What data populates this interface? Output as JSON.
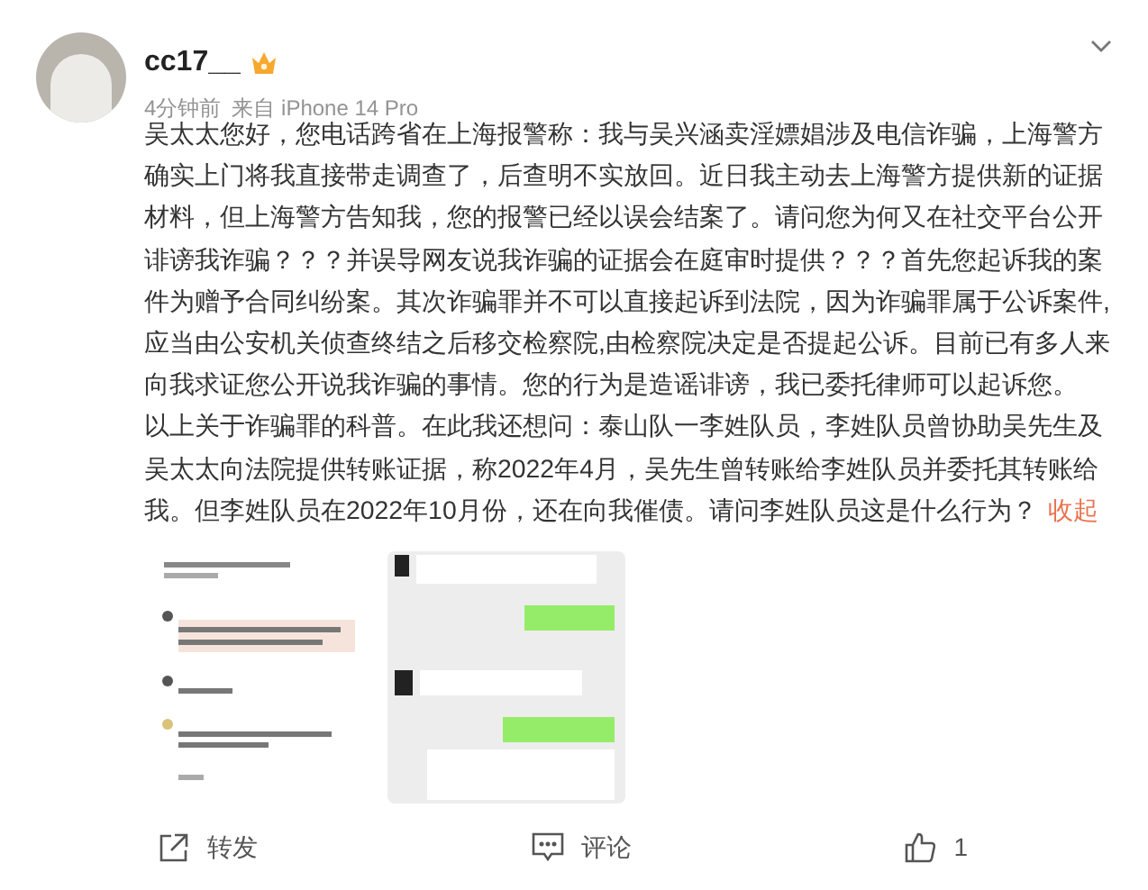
{
  "post": {
    "username": "cc17__",
    "time": "4分钟前",
    "source": "来自 iPhone 14 Pro",
    "paragraphs": [
      "吴太太您好，您电话跨省在上海报警称：我与吴兴涵卖淫嫖娼涉及电信诈骗，上海警方确实上门将我直接带走调查了，后查明不实放回。近日我主动去上海警方提供新的证据材料，但上海警方告知我，您的报警已经以误会结案了。请问您为何又在社交平台公开诽谤我诈骗？？？并误导网友说我诈骗的证据会在庭审时提供？？？首先您起诉我的案件为赠予合同纠纷案。其次诈骗罪并不可以直接起诉到法院，因为诈骗罪属于公诉案件,应当由公安机关侦查终结之后移交检察院,由检察院决定是否提起公诉。目前已有多人来向我求证您公开说我诈骗的事情。您的行为是造谣诽谤，我已委托律师可以起诉您。",
      "以上关于诈骗罪的科普。在此我还想问：泰山队一李姓队员，李姓队员曾协助吴先生及吴太太向法院提供转账证据，称2022年4月，吴先生曾转账给李姓队员并委托其转账给我。但李姓队员在2022年10月份，还在向我催债。请问李姓队员这是什么行为？"
    ],
    "collapse_link": "收起",
    "images": [
      {
        "kind": "picture"
      },
      {
        "kind": "picture"
      }
    ],
    "actions": [
      {
        "kind": "repost",
        "label": "转发"
      },
      {
        "kind": "comment",
        "label": "评论"
      },
      {
        "kind": "like",
        "label": "1"
      }
    ]
  }
}
